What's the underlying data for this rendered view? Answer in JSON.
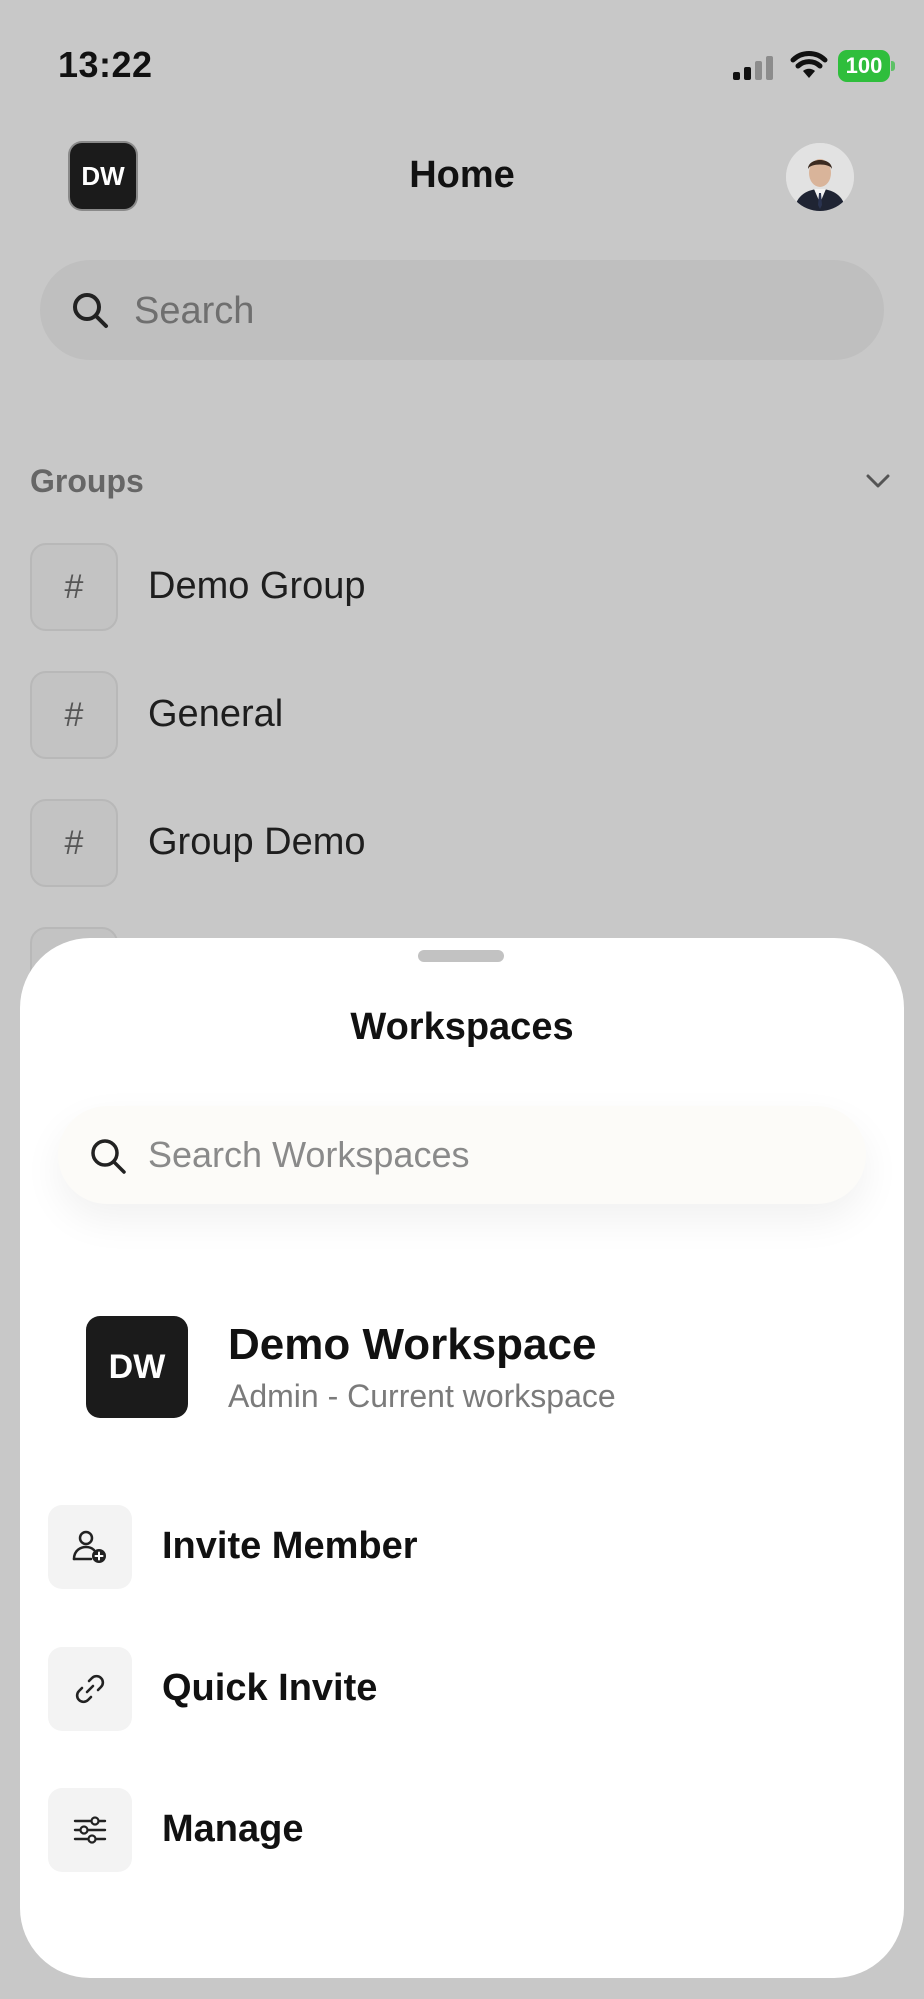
{
  "status_bar": {
    "time": "13:22",
    "battery": "100"
  },
  "header": {
    "workspace_initials": "DW",
    "title": "Home"
  },
  "search": {
    "placeholder": "Search"
  },
  "groups": {
    "label": "Groups",
    "items": [
      {
        "icon": "#",
        "name": "Demo Group"
      },
      {
        "icon": "#",
        "name": "General"
      },
      {
        "icon": "#",
        "name": "Group Demo"
      }
    ]
  },
  "sheet": {
    "title": "Workspaces",
    "search_placeholder": "Search Workspaces",
    "current_workspace": {
      "initials": "DW",
      "name": "Demo Workspace",
      "subtitle": "Admin - Current workspace"
    },
    "actions": [
      {
        "icon": "add-user-icon",
        "label": "Invite Member"
      },
      {
        "icon": "link-icon",
        "label": "Quick Invite"
      },
      {
        "icon": "sliders-icon",
        "label": "Manage"
      }
    ]
  },
  "colors": {
    "battery": "#2fbe3c",
    "overlay_bg": "#c8c8c8",
    "badge_bg": "#1b1b1b"
  }
}
